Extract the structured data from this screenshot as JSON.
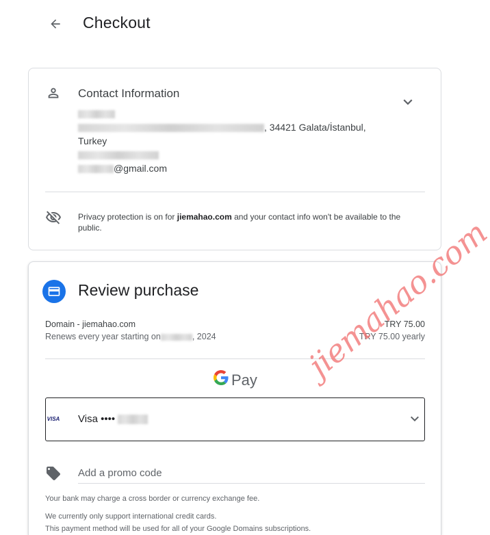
{
  "header": {
    "title": "Checkout",
    "back_icon": "arrow-left-icon"
  },
  "contact": {
    "title": "Contact Information",
    "address_line_suffix": ", 34421 Galata/İstanbul,",
    "country": "Turkey",
    "email_suffix": "@gmail.com",
    "privacy_prefix": "Privacy protection is on for ",
    "privacy_domain": "jiemahao.com",
    "privacy_suffix": " and your contact info won't be available to the public."
  },
  "review": {
    "title": "Review purchase",
    "item_label": "Domain - jiemahao.com",
    "item_price": "TRY 75.00",
    "renew_prefix": "Renews every year starting on",
    "renew_year": ", 2024",
    "renew_price": "TRY 75.00 yearly",
    "gpay_text": "Pay",
    "card_brand": "VISA",
    "card_label": "Visa ••••",
    "promo_placeholder": "Add a promo code",
    "note_1": "Your bank may charge a cross border or currency exchange fee.",
    "note_2": "We currently only support international credit cards.",
    "note_3": "This payment method will be used for all of your Google Domains subscriptions."
  },
  "watermark": "jiemahao.com",
  "colors": {
    "accent": "#1a73e8",
    "border": "#dadce0",
    "watermark": "#f06e6e"
  }
}
